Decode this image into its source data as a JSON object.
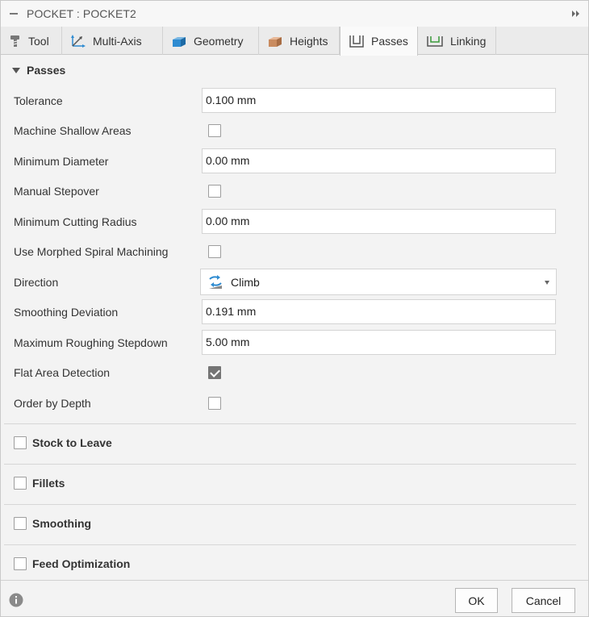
{
  "window": {
    "title": "POCKET : POCKET2"
  },
  "tabs": [
    {
      "label": "Tool",
      "icon": "tool-icon"
    },
    {
      "label": "Multi-Axis",
      "icon": "multi-axis-icon"
    },
    {
      "label": "Geometry",
      "icon": "geometry-icon"
    },
    {
      "label": "Heights",
      "icon": "heights-icon"
    },
    {
      "label": "Passes",
      "icon": "passes-icon",
      "active": true
    },
    {
      "label": "Linking",
      "icon": "linking-icon"
    }
  ],
  "passes": {
    "section_title": "Passes",
    "tolerance": {
      "label": "Tolerance",
      "value": "0.100 mm"
    },
    "machine_shallow_areas": {
      "label": "Machine Shallow Areas",
      "checked": false
    },
    "minimum_diameter": {
      "label": "Minimum Diameter",
      "value": "0.00 mm"
    },
    "manual_stepover": {
      "label": "Manual Stepover",
      "checked": false
    },
    "minimum_cutting_radius": {
      "label": "Minimum Cutting Radius",
      "value": "0.00 mm"
    },
    "use_morphed_spiral": {
      "label": "Use Morphed Spiral Machining",
      "checked": false
    },
    "direction": {
      "label": "Direction",
      "value": "Climb",
      "icon": "climb-icon"
    },
    "smoothing_deviation": {
      "label": "Smoothing Deviation",
      "value": "0.191 mm"
    },
    "max_roughing_stepdown": {
      "label": "Maximum Roughing Stepdown",
      "value": "5.00 mm"
    },
    "flat_area_detection": {
      "label": "Flat Area Detection",
      "checked": true
    },
    "order_by_depth": {
      "label": "Order by Depth",
      "checked": false
    }
  },
  "groups": [
    {
      "label": "Stock to Leave",
      "checked": false
    },
    {
      "label": "Fillets",
      "checked": false
    },
    {
      "label": "Smoothing",
      "checked": false
    },
    {
      "label": "Feed Optimization",
      "checked": false
    }
  ],
  "footer": {
    "ok_label": "OK",
    "cancel_label": "Cancel",
    "info_icon": "info-icon"
  },
  "colors": {
    "accent_blue": "#2e8bd1",
    "checkbox_checked": "#747474"
  }
}
